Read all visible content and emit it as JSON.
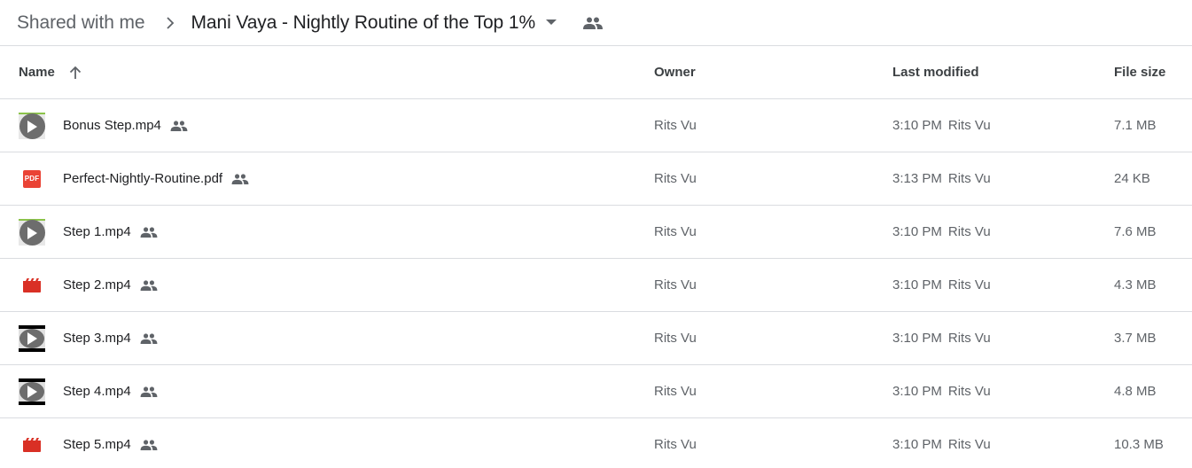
{
  "breadcrumb": {
    "root": "Shared with me",
    "separator_icon": "chevron-right-icon",
    "current": "Mani Vaya - Nightly Routine of the Top 1%",
    "dropdown_icon": "arrow-drop-down-icon",
    "shared_icon": "people-icon"
  },
  "table": {
    "columns": {
      "name": "Name",
      "owner": "Owner",
      "last_modified": "Last modified",
      "file_size": "File size"
    },
    "sort": {
      "column": "name",
      "direction": "ascending",
      "icon": "arrow-up-icon"
    },
    "rows": [
      {
        "name": "Bonus Step.mp4",
        "icon": "video-thumbnail-icon",
        "shared": true,
        "owner": "Rits Vu",
        "modified_time": "3:10 PM",
        "modified_by": "Rits Vu",
        "size": "7.1 MB"
      },
      {
        "name": "Perfect-Nightly-Routine.pdf",
        "icon": "pdf-icon",
        "icon_label": "PDF",
        "shared": true,
        "owner": "Rits Vu",
        "modified_time": "3:13 PM",
        "modified_by": "Rits Vu",
        "size": "24 KB"
      },
      {
        "name": "Step 1.mp4",
        "icon": "video-thumbnail-icon",
        "shared": true,
        "owner": "Rits Vu",
        "modified_time": "3:10 PM",
        "modified_by": "Rits Vu",
        "size": "7.6 MB"
      },
      {
        "name": "Step 2.mp4",
        "icon": "video-file-icon",
        "shared": true,
        "owner": "Rits Vu",
        "modified_time": "3:10 PM",
        "modified_by": "Rits Vu",
        "size": "4.3 MB"
      },
      {
        "name": "Step 3.mp4",
        "icon": "video-thumbnail-icon",
        "shared": true,
        "owner": "Rits Vu",
        "modified_time": "3:10 PM",
        "modified_by": "Rits Vu",
        "size": "3.7 MB"
      },
      {
        "name": "Step 4.mp4",
        "icon": "video-thumbnail-icon",
        "shared": true,
        "owner": "Rits Vu",
        "modified_time": "3:10 PM",
        "modified_by": "Rits Vu",
        "size": "4.8 MB"
      },
      {
        "name": "Step 5.mp4",
        "icon": "video-file-icon",
        "shared": true,
        "owner": "Rits Vu",
        "modified_time": "3:10 PM",
        "modified_by": "Rits Vu",
        "size": "10.3 MB"
      }
    ]
  },
  "colors": {
    "pdf_red": "#ea4335",
    "video_red": "#d93025",
    "divider": "#dadce0",
    "icon_gray": "#5f6368"
  }
}
